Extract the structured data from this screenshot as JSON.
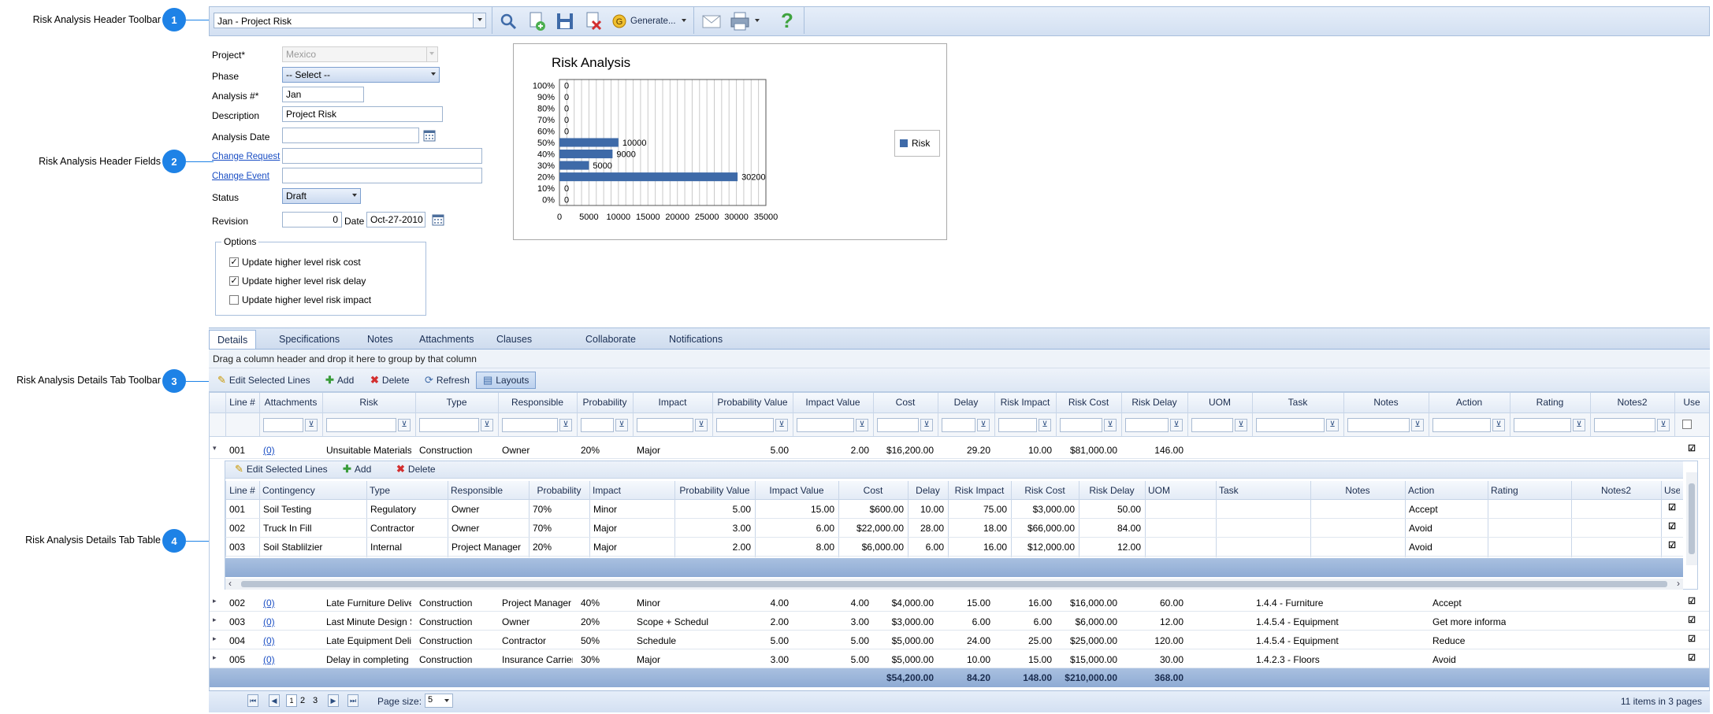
{
  "annotations": [
    {
      "number": "1",
      "label": "Risk Analysis Header Toolbar"
    },
    {
      "number": "2",
      "label": "Risk Analysis Header Fields"
    },
    {
      "number": "3",
      "label": "Risk Analysis Details Tab Toolbar"
    },
    {
      "number": "4",
      "label": "Risk Analysis Details Tab Table"
    }
  ],
  "header_toolbar": {
    "record_select": "Jan - Project Risk",
    "generate_label": "Generate...",
    "icons": [
      "search-icon",
      "add-icon",
      "save-icon",
      "delete-icon",
      "generate-icon",
      "email-icon",
      "print-icon",
      "help-icon"
    ],
    "help_glyph": "?"
  },
  "header_fields": {
    "project_label": "Project*",
    "project_value": "Mexico",
    "phase_label": "Phase",
    "phase_value": "-- Select --",
    "analysis_no_label": "Analysis #*",
    "analysis_no_value": "Jan",
    "description_label": "Description",
    "description_value": "Project Risk",
    "analysis_date_label": "Analysis Date",
    "analysis_date_value": "",
    "change_request_label": "Change Request",
    "change_event_label": "Change Event",
    "status_label": "Status",
    "status_value": "Draft",
    "revision_label": "Revision",
    "revision_value": "0",
    "date_label": "Date",
    "date_value": "Oct-27-2010",
    "options_title": "Options",
    "options": [
      {
        "label": "Update higher level risk cost",
        "checked": true
      },
      {
        "label": "Update higher level risk delay",
        "checked": true
      },
      {
        "label": "Update higher level risk impact",
        "checked": false
      }
    ]
  },
  "chart_data": {
    "type": "bar",
    "orientation": "horizontal",
    "title": "Risk Analysis",
    "categories": [
      "100%",
      "90%",
      "80%",
      "70%",
      "60%",
      "50%",
      "40%",
      "30%",
      "20%",
      "10%",
      "0%"
    ],
    "series": [
      {
        "name": "Risk",
        "values": [
          0,
          0,
          0,
          0,
          0,
          10000,
          9000,
          5000,
          30200,
          0,
          0
        ]
      }
    ],
    "data_labels": [
      "0",
      "0",
      "0",
      "0",
      "0",
      "10000",
      "9000",
      "5000",
      "30200",
      "0",
      "0"
    ],
    "x_ticks": [
      "0",
      "5000",
      "10000",
      "15000",
      "20000",
      "25000",
      "30000",
      "35000"
    ],
    "xlim": [
      0,
      35000
    ],
    "grid": true,
    "legend_position": "right",
    "color": "#3e6aa8"
  },
  "tabs": [
    "Details",
    "Specifications",
    "Notes",
    "Attachments",
    "Clauses",
    "Collaborate",
    "Notifications"
  ],
  "active_tab": "Details",
  "group_hint": "Drag a column header and drop it here to group by that column",
  "details_toolbar": {
    "edit_label": "Edit Selected Lines",
    "add_label": "Add",
    "delete_label": "Delete",
    "refresh_label": "Refresh",
    "layouts_label": "Layouts"
  },
  "main_table": {
    "columns": [
      "Line #",
      "Attachments",
      "Risk",
      "Type",
      "Responsible",
      "Probability",
      "Impact",
      "Probability Value",
      "Impact Value",
      "Cost",
      "Delay",
      "Risk Impact",
      "Risk Cost",
      "Risk Delay",
      "UOM",
      "Task",
      "Notes",
      "Action",
      "Rating",
      "Notes2",
      "Use"
    ],
    "rows": [
      {
        "line": "001",
        "attachments": "(0)",
        "risk": "Unsuitable Materials",
        "type": "Construction",
        "responsible": "Owner",
        "probability": "20%",
        "impact": "Major",
        "prob_value": "5.00",
        "impact_value": "2.00",
        "cost": "$16,200.00",
        "delay": "29.20",
        "risk_impact": "10.00",
        "risk_cost": "$81,000.00",
        "risk_delay": "146.00",
        "uom": "",
        "task": "",
        "notes": "",
        "action": "",
        "rating": "",
        "notes2": "",
        "use": true,
        "expanded": true
      },
      {
        "line": "002",
        "attachments": "(0)",
        "risk": "Late Furniture Delivery",
        "type": "Construction",
        "responsible": "Project Manager",
        "probability": "40%",
        "impact": "Minor",
        "prob_value": "4.00",
        "impact_value": "4.00",
        "cost": "$4,000.00",
        "delay": "15.00",
        "risk_impact": "16.00",
        "risk_cost": "$16,000.00",
        "risk_delay": "60.00",
        "uom": "",
        "task": "1.4.4 - Furniture",
        "notes": "",
        "action": "Accept",
        "rating": "",
        "notes2": "",
        "use": true,
        "expanded": false
      },
      {
        "line": "003",
        "attachments": "(0)",
        "risk": "Last Minute Design Scope",
        "type": "Construction",
        "responsible": "Owner",
        "probability": "20%",
        "impact": "Scope + Schedule",
        "prob_value": "2.00",
        "impact_value": "3.00",
        "cost": "$3,000.00",
        "delay": "6.00",
        "risk_impact": "6.00",
        "risk_cost": "$6,000.00",
        "risk_delay": "12.00",
        "uom": "",
        "task": "1.4.5.4 - Equipment",
        "notes": "",
        "action": "Get more information",
        "rating": "",
        "notes2": "",
        "use": true,
        "expanded": false
      },
      {
        "line": "004",
        "attachments": "(0)",
        "risk": "Late Equipment Delivery",
        "type": "Construction",
        "responsible": "Contractor",
        "probability": "50%",
        "impact": "Schedule",
        "prob_value": "5.00",
        "impact_value": "5.00",
        "cost": "$5,000.00",
        "delay": "24.00",
        "risk_impact": "25.00",
        "risk_cost": "$25,000.00",
        "risk_delay": "120.00",
        "uom": "",
        "task": "1.4.5.4 - Equipment",
        "notes": "",
        "action": "Reduce",
        "rating": "",
        "notes2": "",
        "use": true,
        "expanded": false
      },
      {
        "line": "005",
        "attachments": "(0)",
        "risk": "Delay in completing construction",
        "type": "Construction",
        "responsible": "Insurance Carrier",
        "probability": "30%",
        "impact": "Major",
        "prob_value": "3.00",
        "impact_value": "5.00",
        "cost": "$5,000.00",
        "delay": "10.00",
        "risk_impact": "15.00",
        "risk_cost": "$15,000.00",
        "risk_delay": "30.00",
        "uom": "",
        "task": "1.4.2.3 - Floors",
        "notes": "",
        "action": "Avoid",
        "rating": "",
        "notes2": "",
        "use": true,
        "expanded": false
      }
    ],
    "totals": {
      "cost": "$54,200.00",
      "delay": "84.20",
      "risk_impact": "148.00",
      "risk_cost": "$210,000.00",
      "risk_delay": "368.00"
    }
  },
  "sub_toolbar": {
    "edit_label": "Edit Selected Lines",
    "add_label": "Add",
    "delete_label": "Delete"
  },
  "sub_table": {
    "columns": [
      "Line #",
      "Contingency",
      "Type",
      "Responsible",
      "Probability",
      "Impact",
      "Probability Value",
      "Impact Value",
      "Cost",
      "Delay",
      "Risk Impact",
      "Risk Cost",
      "Risk Delay",
      "UOM",
      "Task",
      "Notes",
      "Action",
      "Rating",
      "Notes2",
      "Use"
    ],
    "rows": [
      {
        "line": "001",
        "contingency": "Soil Testing",
        "type": "Regulatory",
        "responsible": "Owner",
        "probability": "70%",
        "impact": "Minor",
        "prob_value": "5.00",
        "impact_value": "15.00",
        "cost": "$600.00",
        "delay": "10.00",
        "risk_impact": "75.00",
        "risk_cost": "$3,000.00",
        "risk_delay": "50.00",
        "action": "Accept",
        "use": true
      },
      {
        "line": "002",
        "contingency": "Truck In Fill",
        "type": "Contractor",
        "responsible": "Owner",
        "probability": "70%",
        "impact": "Major",
        "prob_value": "3.00",
        "impact_value": "6.00",
        "cost": "$22,000.00",
        "delay": "28.00",
        "risk_impact": "18.00",
        "risk_cost": "$66,000.00",
        "risk_delay": "84.00",
        "action": "Avoid",
        "use": true
      },
      {
        "line": "003",
        "contingency": "Soil Stablilzier",
        "type": "Internal",
        "responsible": "Project Manager",
        "probability": "20%",
        "impact": "Major",
        "prob_value": "2.00",
        "impact_value": "8.00",
        "cost": "$6,000.00",
        "delay": "6.00",
        "risk_impact": "16.00",
        "risk_cost": "$12,000.00",
        "risk_delay": "12.00",
        "action": "Avoid",
        "use": true
      }
    ]
  },
  "pager": {
    "pages": [
      "1",
      "2",
      "3"
    ],
    "current_page": "1",
    "page_size_label": "Page size:",
    "page_size_value": "5",
    "summary": "11 items in 3 pages"
  }
}
